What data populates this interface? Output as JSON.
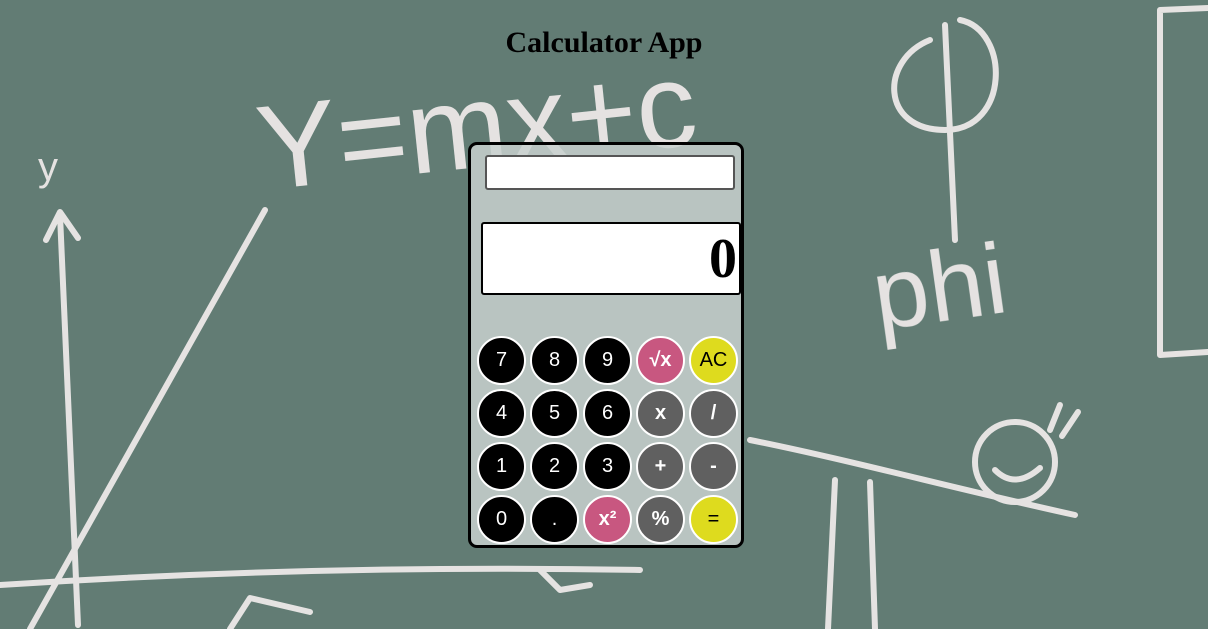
{
  "page": {
    "title": "Calculator App"
  },
  "calculator": {
    "expression_value": "",
    "display_value": "0",
    "keys": [
      {
        "label": "7",
        "kind": "digit",
        "name": "key-7"
      },
      {
        "label": "8",
        "kind": "digit",
        "name": "key-8"
      },
      {
        "label": "9",
        "kind": "digit",
        "name": "key-9"
      },
      {
        "label": "√x",
        "kind": "special",
        "name": "square-root-button"
      },
      {
        "label": "AC",
        "kind": "accent",
        "name": "all-clear-button"
      },
      {
        "label": "4",
        "kind": "digit",
        "name": "key-4"
      },
      {
        "label": "5",
        "kind": "digit",
        "name": "key-5"
      },
      {
        "label": "6",
        "kind": "digit",
        "name": "key-6"
      },
      {
        "label": "x",
        "kind": "op",
        "name": "multiply-button"
      },
      {
        "label": "/",
        "kind": "op",
        "name": "divide-button"
      },
      {
        "label": "1",
        "kind": "digit",
        "name": "key-1"
      },
      {
        "label": "2",
        "kind": "digit",
        "name": "key-2"
      },
      {
        "label": "3",
        "kind": "digit",
        "name": "key-3"
      },
      {
        "label": "+",
        "kind": "op",
        "name": "add-button"
      },
      {
        "label": "-",
        "kind": "op",
        "name": "subtract-button"
      },
      {
        "label": "0",
        "kind": "digit",
        "name": "key-0"
      },
      {
        "label": ".",
        "kind": "digit",
        "name": "decimal-button"
      },
      {
        "label": "x²",
        "kind": "special",
        "name": "square-button"
      },
      {
        "label": "%",
        "kind": "op",
        "name": "percent-button"
      },
      {
        "label": "=",
        "kind": "accent",
        "name": "equals-button"
      }
    ]
  },
  "background": {
    "chalk_text": [
      "y",
      "Y=mx+c",
      "phi"
    ],
    "colors": {
      "board": "#627c74",
      "chalk": "#f1ecec",
      "digit_key": "#000000",
      "operator_key": "#606060",
      "special_key": "#c85780",
      "accent_key": "#dedb1e"
    }
  }
}
